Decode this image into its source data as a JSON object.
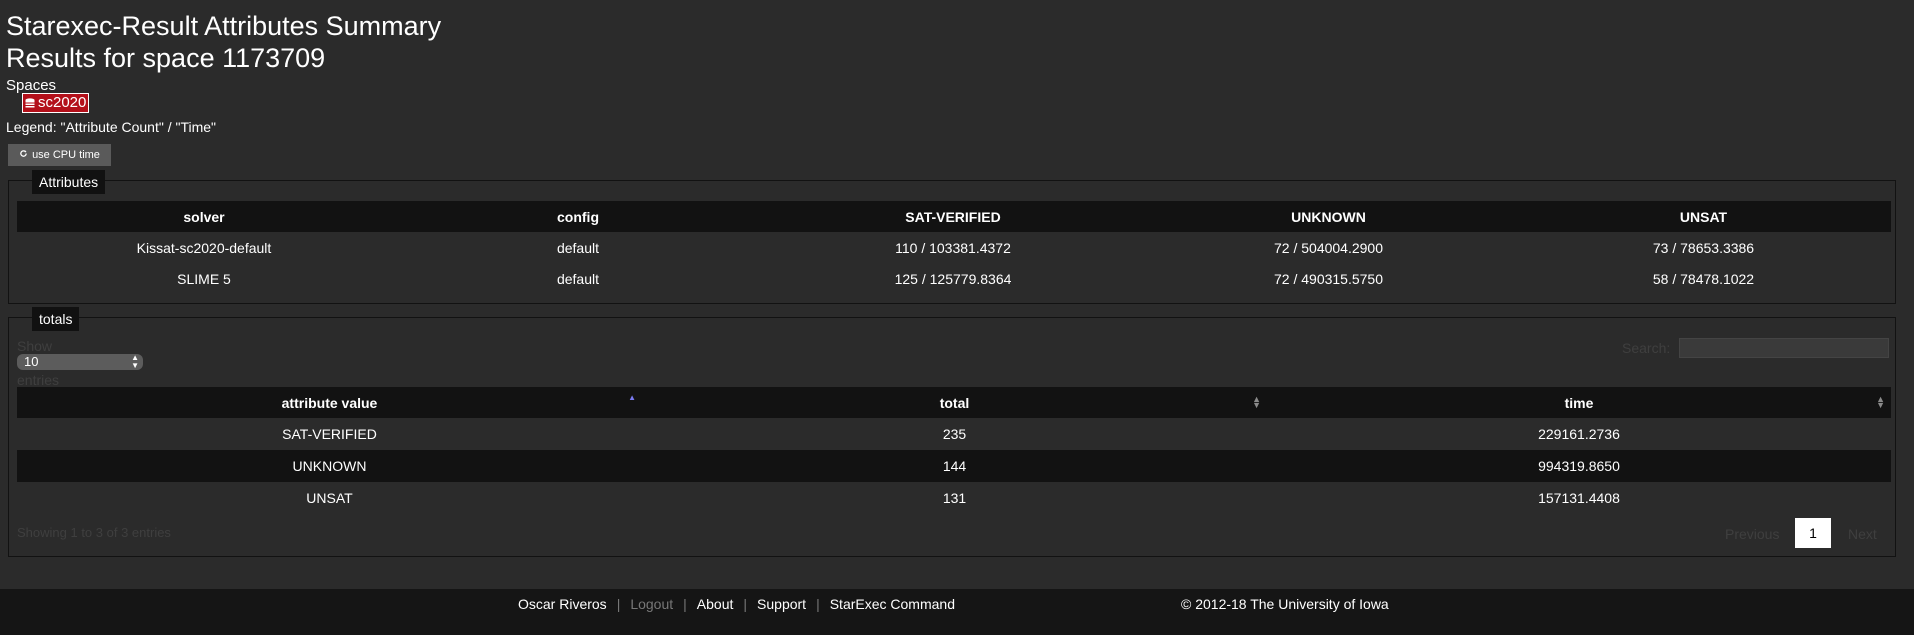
{
  "header": {
    "title": "Starexec-Result Attributes Summary",
    "subtitle": "Results for space 1173709"
  },
  "spaces": {
    "label": "Spaces",
    "items": [
      {
        "label": "sc2020",
        "icon": "database-icon"
      }
    ]
  },
  "legend_text": "Legend: \"Attribute Count\" / \"Time\"",
  "cpu_button": {
    "label": "use CPU time",
    "icon": "refresh-icon"
  },
  "attributes": {
    "legend": "Attributes",
    "columns": [
      "solver",
      "config",
      "SAT-VERIFIED",
      "UNKNOWN",
      "UNSAT"
    ],
    "rows": [
      [
        "Kissat-sc2020-default",
        "default",
        "110 / 103381.4372",
        "72 / 504004.2900",
        "73 / 78653.3386"
      ],
      [
        "SLIME 5",
        "default",
        "125 / 125779.8364",
        "72 / 490315.5750",
        "58 / 78478.1022"
      ]
    ]
  },
  "totals": {
    "legend": "totals",
    "show_label": "Show",
    "entries_label": "entries",
    "page_size": "10",
    "search_label": "Search:",
    "columns": [
      "attribute value",
      "total",
      "time"
    ],
    "rows": [
      [
        "SAT-VERIFIED",
        "235",
        "229161.2736"
      ],
      [
        "UNKNOWN",
        "144",
        "994319.8650"
      ],
      [
        "UNSAT",
        "131",
        "157131.4408"
      ]
    ],
    "info": "Showing 1 to 3 of 3 entries",
    "previous": "Previous",
    "page": "1",
    "next": "Next"
  },
  "footer": {
    "links": [
      "Oscar Riveros",
      "Logout",
      "About",
      "Support",
      "StarExec Command"
    ],
    "copyright": "© 2012-18 The University of Iowa"
  },
  "colors": {
    "background": "#2b2b2b",
    "header_row": "#121212",
    "space_chip": "#b3101a",
    "button": "#5a5a5a"
  }
}
